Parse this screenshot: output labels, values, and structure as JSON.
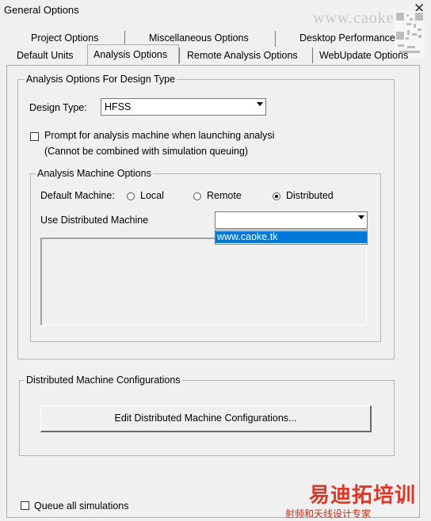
{
  "window": {
    "title": "General Options",
    "close_glyph": "✕"
  },
  "watermarks": {
    "top_url": "www.caoke.tk",
    "brand": "易迪拓培训",
    "brand_sub": "射频和天线设计专家"
  },
  "tabs_row1": [
    {
      "label": "Project Options"
    },
    {
      "label": "Miscellaneous Options"
    },
    {
      "label": "Desktop Performance"
    }
  ],
  "tabs_row2": [
    {
      "label": "Default Units"
    },
    {
      "label": "Analysis Options",
      "active": true
    },
    {
      "label": "Remote Analysis Options"
    },
    {
      "label": "WebUpdate Options"
    }
  ],
  "design_group": {
    "legend": "Analysis Options For Design Type",
    "design_type_label": "Design Type:",
    "design_type_value": "HFSS",
    "prompt_label": "Prompt for analysis machine when launching analysi",
    "prompt_checked": false,
    "prompt_note": "(Cannot be combined with simulation queuing)",
    "machine_group": {
      "legend": "Analysis Machine Options",
      "default_machine_label": "Default Machine:",
      "radios": [
        {
          "label": "Local",
          "checked": false
        },
        {
          "label": "Remote",
          "checked": false
        },
        {
          "label": "Distributed",
          "checked": true
        }
      ],
      "use_distributed_label": "Use Distributed Machine",
      "dropdown_value": "",
      "dropdown_open_item": "www.caoke.tk"
    }
  },
  "distributed_config": {
    "legend": "Distributed Machine Configurations",
    "edit_button": "Edit Distributed Machine Configurations..."
  },
  "queue_all": {
    "label": "Queue all simulations",
    "checked": false
  }
}
